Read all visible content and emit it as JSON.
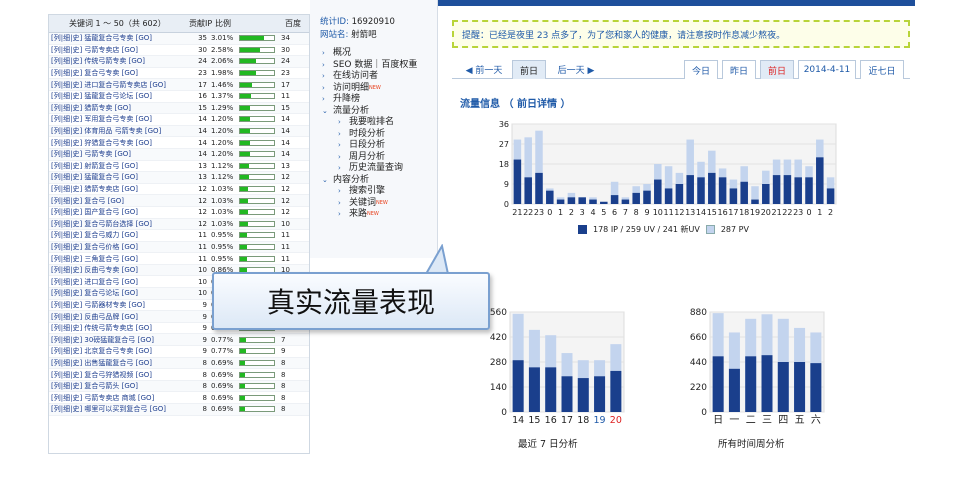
{
  "keyword_table": {
    "header_title": "关键词 1 ～ 50（共 602）",
    "header_ip": "贡献IP",
    "header_ratio": "比例",
    "header_extra": "百度",
    "rows": [
      {
        "kw": "[列|细|史] 猛龍复合弓专卖 [GO]",
        "ip": "35",
        "pct": "3.01%",
        "ratio": 0.7,
        "n1": "34"
      },
      {
        "kw": "[列|细|史] 弓箭专卖店 [GO]",
        "ip": "30",
        "pct": "2.58%",
        "ratio": 0.6,
        "n1": "30"
      },
      {
        "kw": "[列|细|史] 传统弓箭专卖 [GO]",
        "ip": "24",
        "pct": "2.06%",
        "ratio": 0.48,
        "n1": "24"
      },
      {
        "kw": "[列|细|史] 复合弓专卖 [GO]",
        "ip": "23",
        "pct": "1.98%",
        "ratio": 0.46,
        "n1": "23"
      },
      {
        "kw": "[列|细|史] 进口复合弓箭专卖店 [GO]",
        "ip": "17",
        "pct": "1.46%",
        "ratio": 0.34,
        "n1": "17"
      },
      {
        "kw": "[列|细|史] 猛龍复合弓论坛 [GO]",
        "ip": "16",
        "pct": "1.37%",
        "ratio": 0.32,
        "n1": "11"
      },
      {
        "kw": "[列|细|史] 猎箭专卖 [GO]",
        "ip": "15",
        "pct": "1.29%",
        "ratio": 0.3,
        "n1": "15"
      },
      {
        "kw": "[列|细|史] 军用复合弓专卖 [GO]",
        "ip": "14",
        "pct": "1.20%",
        "ratio": 0.28,
        "n1": "14"
      },
      {
        "kw": "[列|细|史] 体育用品 弓箭专卖 [GO]",
        "ip": "14",
        "pct": "1.20%",
        "ratio": 0.28,
        "n1": "14"
      },
      {
        "kw": "[列|细|史] 狩猎复合弓专卖 [GO]",
        "ip": "14",
        "pct": "1.20%",
        "ratio": 0.28,
        "n1": "14"
      },
      {
        "kw": "[列|细|史] 弓箭专卖 [GO]",
        "ip": "14",
        "pct": "1.20%",
        "ratio": 0.28,
        "n1": "14"
      },
      {
        "kw": "[列|细|史] 射箭复合弓 [GO]",
        "ip": "13",
        "pct": "1.12%",
        "ratio": 0.26,
        "n1": "13"
      },
      {
        "kw": "[列|细|史] 猛龍复合弓 [GO]",
        "ip": "13",
        "pct": "1.12%",
        "ratio": 0.26,
        "n1": "12"
      },
      {
        "kw": "[列|细|史] 猎箭专卖店 [GO]",
        "ip": "12",
        "pct": "1.03%",
        "ratio": 0.24,
        "n1": "12"
      },
      {
        "kw": "[列|细|史] 复合弓 [GO]",
        "ip": "12",
        "pct": "1.03%",
        "ratio": 0.24,
        "n1": "12"
      },
      {
        "kw": "[列|细|史] 国产复合弓 [GO]",
        "ip": "12",
        "pct": "1.03%",
        "ratio": 0.24,
        "n1": "12"
      },
      {
        "kw": "[列|细|史] 复合弓箭台选择 [GO]",
        "ip": "12",
        "pct": "1.03%",
        "ratio": 0.24,
        "n1": "10"
      },
      {
        "kw": "[列|细|史] 复合弓威力 [GO]",
        "ip": "11",
        "pct": "0.95%",
        "ratio": 0.22,
        "n1": "11"
      },
      {
        "kw": "[列|细|史] 复合弓价格 [GO]",
        "ip": "11",
        "pct": "0.95%",
        "ratio": 0.22,
        "n1": "11"
      },
      {
        "kw": "[列|细|史] 三角复合弓 [GO]",
        "ip": "11",
        "pct": "0.95%",
        "ratio": 0.22,
        "n1": "11"
      },
      {
        "kw": "[列|细|史] 反曲弓专卖 [GO]",
        "ip": "10",
        "pct": "0.86%",
        "ratio": 0.2,
        "n1": "10"
      },
      {
        "kw": "[列|细|史] 进口复合弓 [GO]",
        "ip": "10",
        "pct": "0.86%",
        "ratio": 0.2,
        "n1": "10"
      },
      {
        "kw": "[列|细|史] 复合弓论坛 [GO]",
        "ip": "10",
        "pct": "0.86%",
        "ratio": 0.2,
        "n1": "10"
      },
      {
        "kw": "[列|细|史] 弓箭器材专卖 [GO]",
        "ip": "9",
        "pct": "0.77%",
        "ratio": 0.18,
        "n1": "9"
      },
      {
        "kw": "[列|细|史] 反曲弓品牌 [GO]",
        "ip": "9",
        "pct": "0.77%",
        "ratio": 0.18,
        "n1": "9"
      },
      {
        "kw": "[列|细|史] 传统弓箭专卖店 [GO]",
        "ip": "9",
        "pct": "0.77%",
        "ratio": 0.18,
        "n1": "9"
      },
      {
        "kw": "[列|细|史] 30磅猛龍复合弓 [GO]",
        "ip": "9",
        "pct": "0.77%",
        "ratio": 0.18,
        "n1": "7"
      },
      {
        "kw": "[列|细|史] 北京复合弓专卖 [GO]",
        "ip": "9",
        "pct": "0.77%",
        "ratio": 0.18,
        "n1": "9"
      },
      {
        "kw": "[列|细|史] 出售猛龍复合弓 [GO]",
        "ip": "8",
        "pct": "0.69%",
        "ratio": 0.16,
        "n1": "8"
      },
      {
        "kw": "[列|细|史] 复合弓狩猎视频 [GO]",
        "ip": "8",
        "pct": "0.69%",
        "ratio": 0.16,
        "n1": "8"
      },
      {
        "kw": "[列|细|史] 复合弓箭头 [GO]",
        "ip": "8",
        "pct": "0.69%",
        "ratio": 0.16,
        "n1": "8"
      },
      {
        "kw": "[列|细|史] 弓箭专卖店 商城 [GO]",
        "ip": "8",
        "pct": "0.69%",
        "ratio": 0.16,
        "n1": "8"
      },
      {
        "kw": "[列|细|史] 哪里可以买到复合弓 [GO]",
        "ip": "8",
        "pct": "0.69%",
        "ratio": 0.16,
        "n1": "8"
      }
    ]
  },
  "site": {
    "id_label": "统计ID:",
    "id_value": "16920910",
    "name_label": "网站名:",
    "name_value": "射箭吧"
  },
  "nav": [
    {
      "label": "概况",
      "level": 0,
      "new": false
    },
    {
      "label": "SEO 数据｜百度权重",
      "level": 0,
      "new": false
    },
    {
      "label": "在线访问者",
      "level": 0,
      "new": false
    },
    {
      "label": "访问明细",
      "level": 0,
      "new": true
    },
    {
      "label": "升降榜",
      "level": 0,
      "new": false
    },
    {
      "label": "流量分析",
      "level": 0,
      "new": false,
      "open": true
    },
    {
      "label": "我要啦排名",
      "level": 1,
      "new": false
    },
    {
      "label": "时段分析",
      "level": 1,
      "new": false
    },
    {
      "label": "日段分析",
      "level": 1,
      "new": false
    },
    {
      "label": "周月分析",
      "level": 1,
      "new": false
    },
    {
      "label": "历史流量查询",
      "level": 1,
      "new": false
    },
    {
      "label": "内容分析",
      "level": 0,
      "new": false,
      "open": true
    },
    {
      "label": "搜索引擎",
      "level": 1,
      "new": false
    },
    {
      "label": "关键词",
      "level": 1,
      "new": true
    },
    {
      "label": "来路",
      "level": 1,
      "new": true
    }
  ],
  "new_tag": "NEW",
  "reminder": "提醒：已经是夜里 23 点多了，为了您和家人的健康，请注意按时作息减少熬夜。",
  "tabs": {
    "prev": "◀ 前一天",
    "yesterday": "昨日",
    "next": "后一天 ▶",
    "today": "今日",
    "yesterday2": "昨日",
    "ago": "前日",
    "date": "2014-4-11",
    "week": "近七日",
    "active_left": "前日"
  },
  "flow_title": "流量信息 （ 前日详情 ）",
  "legend": {
    "a": "178 IP / 259 UV / 241 新UV",
    "b": "287 PV"
  },
  "callout": "真实流量表现",
  "cap_week": "最近 7 日分析",
  "cap_weekday": "所有时间周分析",
  "colors": {
    "dark": "#1a3f8c",
    "light": "#c3d4ee",
    "bar": "#22b822"
  },
  "chart_data": [
    {
      "type": "bar",
      "title": "",
      "categories": [
        "21",
        "22",
        "23",
        "0",
        "1",
        "2",
        "3",
        "4",
        "5",
        "6",
        "7",
        "8",
        "9",
        "10",
        "11",
        "12",
        "13",
        "14",
        "15",
        "16",
        "17",
        "18",
        "19",
        "20",
        "21",
        "22",
        "23",
        "0",
        "1",
        "2"
      ],
      "series": [
        {
          "name": "178 IP / 259 UV / 241 新UV",
          "values": [
            20,
            12,
            14,
            6,
            2,
            3,
            3,
            2,
            1,
            4,
            2,
            5,
            6,
            11,
            7,
            9,
            13,
            12,
            14,
            12,
            7,
            10,
            2,
            9,
            13,
            13,
            12,
            12,
            21,
            7
          ]
        },
        {
          "name": "287 PV",
          "values": [
            29,
            30,
            33,
            7,
            3,
            5,
            3,
            3,
            1,
            10,
            3,
            8,
            9,
            18,
            17,
            14,
            29,
            19,
            24,
            16,
            11,
            17,
            8,
            15,
            20,
            20,
            20,
            17,
            29,
            12
          ]
        }
      ],
      "yticks": [
        0,
        9,
        18,
        27,
        36
      ],
      "ylim": [
        0,
        36
      ]
    },
    {
      "type": "bar",
      "title": "",
      "xlabel": "最近 7 日分析",
      "categories": [
        "14",
        "15",
        "16",
        "17",
        "18",
        "19",
        "20"
      ],
      "series": [
        {
          "name": "IP",
          "values": [
            290,
            250,
            250,
            200,
            190,
            200,
            230
          ]
        },
        {
          "name": "PV",
          "values": [
            550,
            460,
            430,
            330,
            290,
            290,
            380
          ]
        }
      ],
      "yticks": [
        "0",
        "140",
        "280",
        "420",
        "560"
      ],
      "ylim": [
        0,
        560
      ]
    },
    {
      "type": "bar",
      "title": "",
      "xlabel": "所有时间周分析",
      "categories": [
        "日",
        "一",
        "二",
        "三",
        "四",
        "五",
        "六"
      ],
      "series": [
        {
          "name": "IP",
          "values": [
            490,
            380,
            490,
            500,
            440,
            440,
            430
          ]
        },
        {
          "name": "PV",
          "values": [
            870,
            700,
            820,
            860,
            820,
            740,
            700
          ]
        }
      ],
      "yticks": [
        "0",
        "220",
        "440",
        "660",
        "880"
      ],
      "ylim": [
        0,
        880
      ]
    }
  ]
}
